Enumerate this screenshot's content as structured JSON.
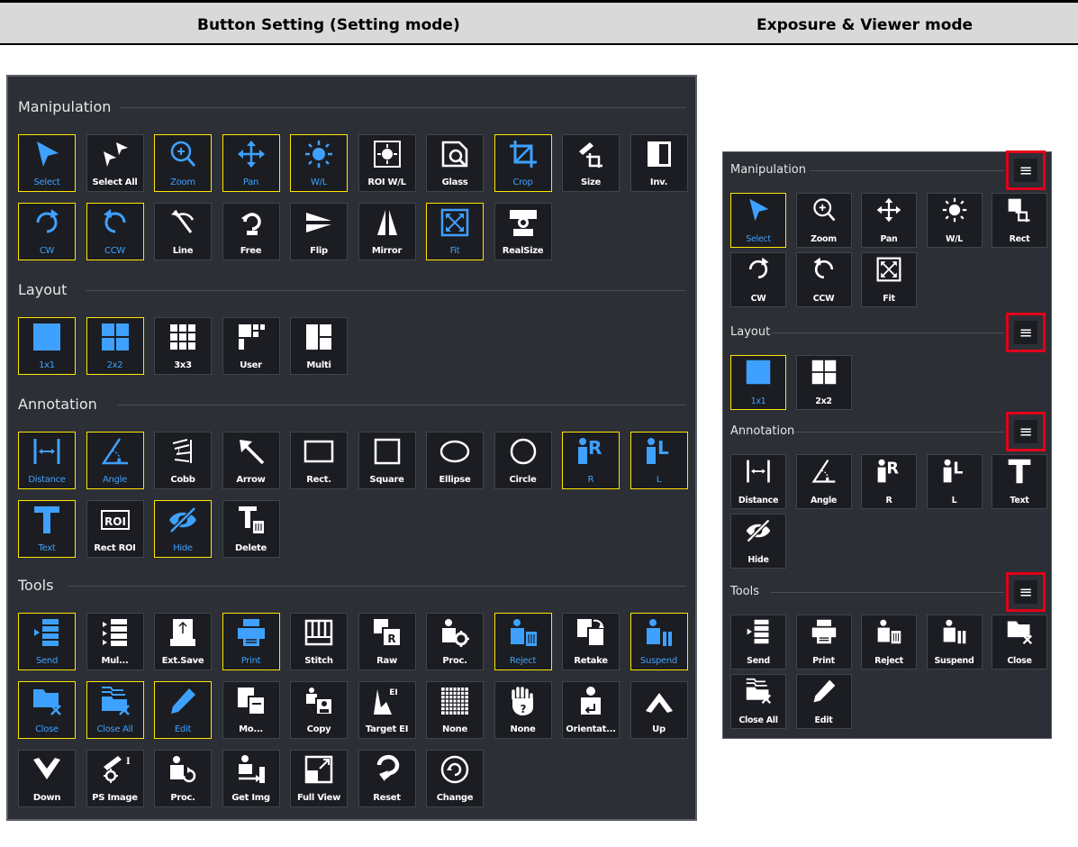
{
  "header": {
    "left_title": "Button Setting (Setting mode)",
    "right_title": "Exposure & Viewer mode"
  },
  "colors": {
    "panel_bg": "#2c2f36",
    "button_bg": "#1b1d22",
    "active_border": "#ffe600",
    "active_text": "#3fa1ff",
    "icon_blue": "#3fa1ff",
    "highlight_red": "#e1001a"
  },
  "setting_mode": {
    "sections": [
      {
        "label": "Manipulation",
        "rows": [
          [
            {
              "label": "Select",
              "icon": "cursor-icon",
              "active": true
            },
            {
              "label": "Select All",
              "icon": "cursors-icon",
              "active": false
            },
            {
              "label": "Zoom",
              "icon": "zoom-icon",
              "active": true
            },
            {
              "label": "Pan",
              "icon": "move-icon",
              "active": true
            },
            {
              "label": "W/L",
              "icon": "brightness-icon",
              "active": true
            },
            {
              "label": "ROI W/L",
              "icon": "roi-brightness-icon",
              "active": false
            },
            {
              "label": "Glass",
              "icon": "magnifier-glass-icon",
              "active": false
            },
            {
              "label": "Crop",
              "icon": "crop-icon",
              "active": true
            },
            {
              "label": "Size",
              "icon": "ruler-crop-icon",
              "active": false
            },
            {
              "label": "Inv.",
              "icon": "invert-icon",
              "active": false
            }
          ],
          [
            {
              "label": "CW",
              "icon": "rotate-cw-icon",
              "active": true
            },
            {
              "label": "CCW",
              "icon": "rotate-ccw-icon",
              "active": true
            },
            {
              "label": "Line",
              "icon": "line-rotate-icon",
              "active": false
            },
            {
              "label": "Free",
              "icon": "free-rotate-icon",
              "active": false
            },
            {
              "label": "Flip",
              "icon": "flip-icon",
              "active": false
            },
            {
              "label": "Mirror",
              "icon": "mirror-icon",
              "active": false
            },
            {
              "label": "Fit",
              "icon": "fit-icon",
              "active": true
            },
            {
              "label": "RealSize",
              "icon": "realsize-icon",
              "active": false
            }
          ]
        ]
      },
      {
        "label": "Layout",
        "rows": [
          [
            {
              "label": "1x1",
              "icon": "layout-1x1-icon",
              "active": true
            },
            {
              "label": "2x2",
              "icon": "layout-2x2-icon",
              "active": true
            },
            {
              "label": "3x3",
              "icon": "layout-3x3-icon",
              "active": false
            },
            {
              "label": "User",
              "icon": "layout-user-icon",
              "active": false
            },
            {
              "label": "Multi",
              "icon": "layout-multi-icon",
              "active": false
            }
          ]
        ]
      },
      {
        "label": "Annotation",
        "rows": [
          [
            {
              "label": "Distance",
              "icon": "distance-icon",
              "active": true
            },
            {
              "label": "Angle",
              "icon": "angle-icon",
              "active": true
            },
            {
              "label": "Cobb",
              "icon": "cobb-icon",
              "active": false
            },
            {
              "label": "Arrow",
              "icon": "arrow-icon",
              "active": false
            },
            {
              "label": "Rect.",
              "icon": "rect-icon",
              "active": false
            },
            {
              "label": "Square",
              "icon": "square-icon",
              "active": false
            },
            {
              "label": "Ellipse",
              "icon": "ellipse-icon",
              "active": false
            },
            {
              "label": "Circle",
              "icon": "circle-icon",
              "active": false
            },
            {
              "label": "R",
              "icon": "marker-r-icon",
              "active": true
            },
            {
              "label": "L",
              "icon": "marker-l-icon",
              "active": true
            }
          ],
          [
            {
              "label": "Text",
              "icon": "text-icon",
              "active": true
            },
            {
              "label": "Rect ROI",
              "icon": "rect-roi-icon",
              "active": false
            },
            {
              "label": "Hide",
              "icon": "hide-icon",
              "active": true
            },
            {
              "label": "Delete",
              "icon": "delete-text-icon",
              "active": false
            }
          ]
        ]
      },
      {
        "label": "Tools",
        "rows": [
          [
            {
              "label": "Send",
              "icon": "send-icon",
              "active": true
            },
            {
              "label": "Mul...",
              "icon": "multi-send-icon",
              "active": false
            },
            {
              "label": "Ext.Save",
              "icon": "usb-save-icon",
              "active": false
            },
            {
              "label": "Print",
              "icon": "printer-icon",
              "active": true
            },
            {
              "label": "Stitch",
              "icon": "stitch-icon",
              "active": false
            },
            {
              "label": "Raw",
              "icon": "raw-icon",
              "active": false
            },
            {
              "label": "Proc.",
              "icon": "process-icon",
              "active": false
            },
            {
              "label": "Reject",
              "icon": "reject-icon",
              "active": true
            },
            {
              "label": "Retake",
              "icon": "retake-icon",
              "active": false
            },
            {
              "label": "Suspend",
              "icon": "suspend-icon",
              "active": true
            }
          ],
          [
            {
              "label": "Close",
              "icon": "close-folder-icon",
              "active": true
            },
            {
              "label": "Close All",
              "icon": "close-all-icon",
              "active": true
            },
            {
              "label": "Edit",
              "icon": "pencil-icon",
              "active": true
            },
            {
              "label": "Mo...",
              "icon": "modify-icon",
              "active": false
            },
            {
              "label": "Copy",
              "icon": "copy-icon",
              "active": false
            },
            {
              "label": "Target EI",
              "icon": "target-ei-icon",
              "active": false
            },
            {
              "label": "None",
              "icon": "grid-pattern-icon",
              "active": false
            },
            {
              "label": "None",
              "icon": "hand-question-icon",
              "active": false
            },
            {
              "label": "Orientat...",
              "icon": "orientation-icon",
              "active": false
            },
            {
              "label": "Up",
              "icon": "chevron-up-icon",
              "active": false
            }
          ],
          [
            {
              "label": "Down",
              "icon": "chevron-down-icon",
              "active": false
            },
            {
              "label": "PS Image",
              "icon": "ps-image-icon",
              "active": false
            },
            {
              "label": "Proc.",
              "icon": "process-reload-icon",
              "active": false
            },
            {
              "label": "Get Img",
              "icon": "get-image-icon",
              "active": false
            },
            {
              "label": "Full View",
              "icon": "full-view-icon",
              "active": false
            },
            {
              "label": "Reset",
              "icon": "reset-icon",
              "active": false
            },
            {
              "label": "Change",
              "icon": "change-icon",
              "active": false
            }
          ]
        ]
      }
    ]
  },
  "viewer_mode": {
    "menu_symbol": "≡",
    "sections": [
      {
        "label": "Manipulation",
        "rows": [
          [
            {
              "label": "Select",
              "icon": "cursor-icon",
              "active": true
            },
            {
              "label": "Zoom",
              "icon": "zoom-icon",
              "active": false
            },
            {
              "label": "Pan",
              "icon": "move-icon",
              "active": false
            },
            {
              "label": "W/L",
              "icon": "brightness-icon",
              "active": false
            },
            {
              "label": "Rect",
              "icon": "rect-crop-icon",
              "active": false
            }
          ],
          [
            {
              "label": "CW",
              "icon": "rotate-cw-icon",
              "active": false
            },
            {
              "label": "CCW",
              "icon": "rotate-ccw-icon",
              "active": false
            },
            {
              "label": "Fit",
              "icon": "fit-icon",
              "active": false
            }
          ]
        ]
      },
      {
        "label": "Layout",
        "rows": [
          [
            {
              "label": "1x1",
              "icon": "layout-1x1-icon",
              "active": true
            },
            {
              "label": "2x2",
              "icon": "layout-2x2-icon",
              "active": false
            }
          ]
        ]
      },
      {
        "label": "Annotation",
        "rows": [
          [
            {
              "label": "Distance",
              "icon": "distance-icon",
              "active": false
            },
            {
              "label": "Angle",
              "icon": "angle-icon",
              "active": false
            },
            {
              "label": "R",
              "icon": "marker-r-icon",
              "active": false
            },
            {
              "label": "L",
              "icon": "marker-l-icon",
              "active": false
            },
            {
              "label": "Text",
              "icon": "text-icon",
              "active": false
            }
          ],
          [
            {
              "label": "Hide",
              "icon": "hide-icon",
              "active": false
            }
          ]
        ]
      },
      {
        "label": "Tools",
        "rows": [
          [
            {
              "label": "Send",
              "icon": "send-icon",
              "active": false
            },
            {
              "label": "Print",
              "icon": "printer-icon",
              "active": false
            },
            {
              "label": "Reject",
              "icon": "reject-icon",
              "active": false
            },
            {
              "label": "Suspend",
              "icon": "suspend-icon",
              "active": false
            },
            {
              "label": "Close",
              "icon": "close-folder-icon",
              "active": false
            }
          ],
          [
            {
              "label": "Close All",
              "icon": "close-all-icon",
              "active": false
            },
            {
              "label": "Edit",
              "icon": "pencil-icon",
              "active": false
            }
          ]
        ]
      }
    ]
  }
}
